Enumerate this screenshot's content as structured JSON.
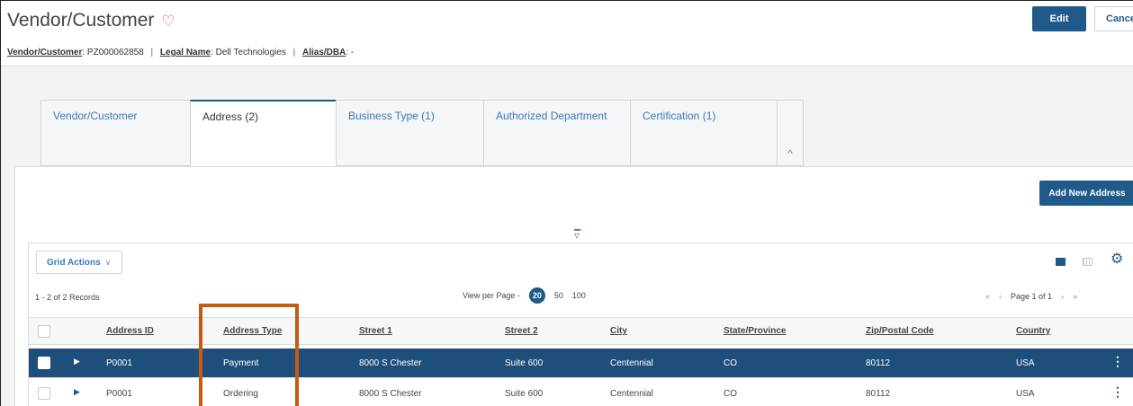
{
  "header": {
    "title": "Vendor/Customer",
    "heart_icon": "heart-outline-icon",
    "edit_label": "Edit",
    "cancel_label": "Cance"
  },
  "meta": {
    "vendor_label": "Vendor/Customer",
    "vendor_value": ": PZ000062858",
    "legal_label": "Legal Name",
    "legal_value": ": Dell Technologies",
    "alias_label": "Alias/DBA",
    "alias_value": ": -",
    "separator": "|"
  },
  "tabs": [
    {
      "label": "Vendor/Customer",
      "active": false
    },
    {
      "label": "Address (2)",
      "active": true
    },
    {
      "label": "Business Type (1)",
      "active": false
    },
    {
      "label": "Authorized Department",
      "active": false
    },
    {
      "label": "Certification (1)",
      "active": false
    }
  ],
  "tab_collapse_glyph": "^",
  "address": {
    "add_button_label": "Add New Address",
    "grid_actions_label": "Grid Actions",
    "records_text": "1 - 2 of 2 Records",
    "view_per_page_label": "View per Page -",
    "per_page_options": [
      "20",
      "50",
      "100"
    ],
    "per_page_selected": "20",
    "pager_text": "Page 1 of 1",
    "columns": [
      "Address ID",
      "Address Type",
      "Street 1",
      "Street 2",
      "City",
      "State/Province",
      "Zip/Postal Code",
      "Country"
    ],
    "rows": [
      {
        "address_id": "P0001",
        "address_type": "Payment",
        "street1": "8000 S Chester",
        "street2": "Suite 600",
        "city": "Centennial",
        "state": "CO",
        "zip": "80112",
        "country": "USA",
        "selected": true
      },
      {
        "address_id": "P0001",
        "address_type": "Ordering",
        "street1": "8000 S Chester",
        "street2": "Suite 600",
        "city": "Centennial",
        "state": "CO",
        "zip": "80112",
        "country": "USA",
        "selected": false
      }
    ]
  },
  "colors": {
    "primary": "#1f5a8a",
    "selected_row": "#1d4f7a",
    "highlight_box": "#c55a11",
    "link": "#3a7ab5"
  }
}
